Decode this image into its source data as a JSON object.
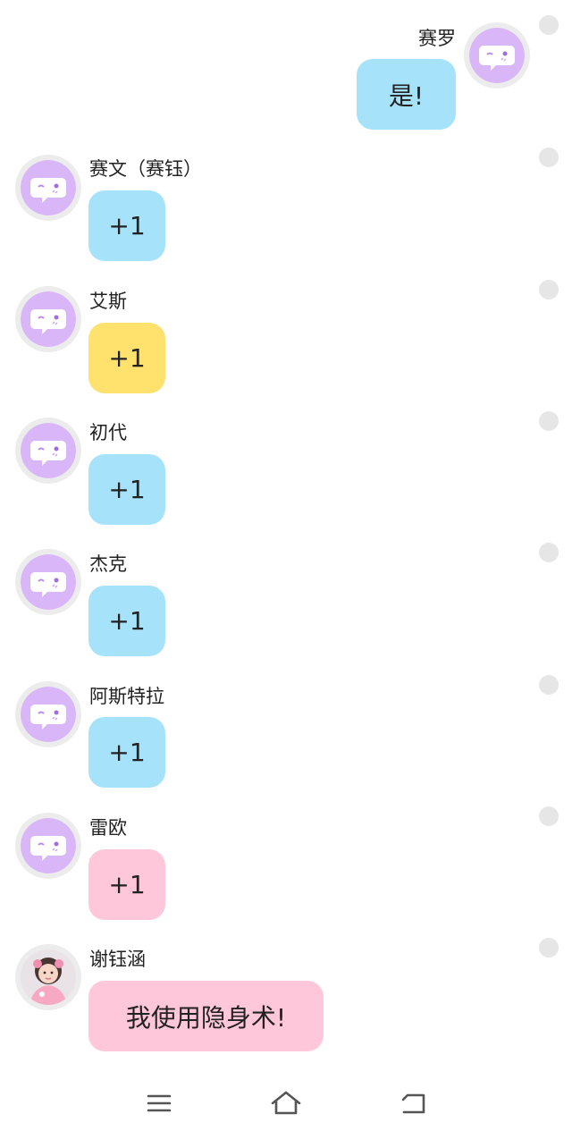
{
  "messages": [
    {
      "sender": "赛罗",
      "text": "是!",
      "side": "right",
      "color": "#a6e3fb",
      "avatar": "chat-bot-icon"
    },
    {
      "sender": "赛文（赛钰）",
      "text": "+1",
      "side": "left",
      "color": "#a6e3fb",
      "avatar": "chat-bot-icon"
    },
    {
      "sender": "艾斯",
      "text": "+1",
      "side": "left",
      "color": "#ffe16e",
      "avatar": "chat-bot-icon"
    },
    {
      "sender": "初代",
      "text": "+1",
      "side": "left",
      "color": "#a6e3fb",
      "avatar": "chat-bot-icon"
    },
    {
      "sender": "杰克",
      "text": "+1",
      "side": "left",
      "color": "#a6e3fb",
      "avatar": "chat-bot-icon"
    },
    {
      "sender": "阿斯特拉",
      "text": "+1",
      "side": "left",
      "color": "#a6e3fb",
      "avatar": "chat-bot-icon"
    },
    {
      "sender": "雷欧",
      "text": "+1",
      "side": "left",
      "color": "#ffc7d9",
      "avatar": "chat-bot-icon"
    },
    {
      "sender": "谢钰涵",
      "text": "我使用隐身术!",
      "side": "left",
      "color": "#ffc7d9",
      "avatar": "user-photo"
    }
  ],
  "navbar": {
    "menu_icon": "menu-icon",
    "home_icon": "home-icon",
    "back_icon": "back-icon"
  }
}
